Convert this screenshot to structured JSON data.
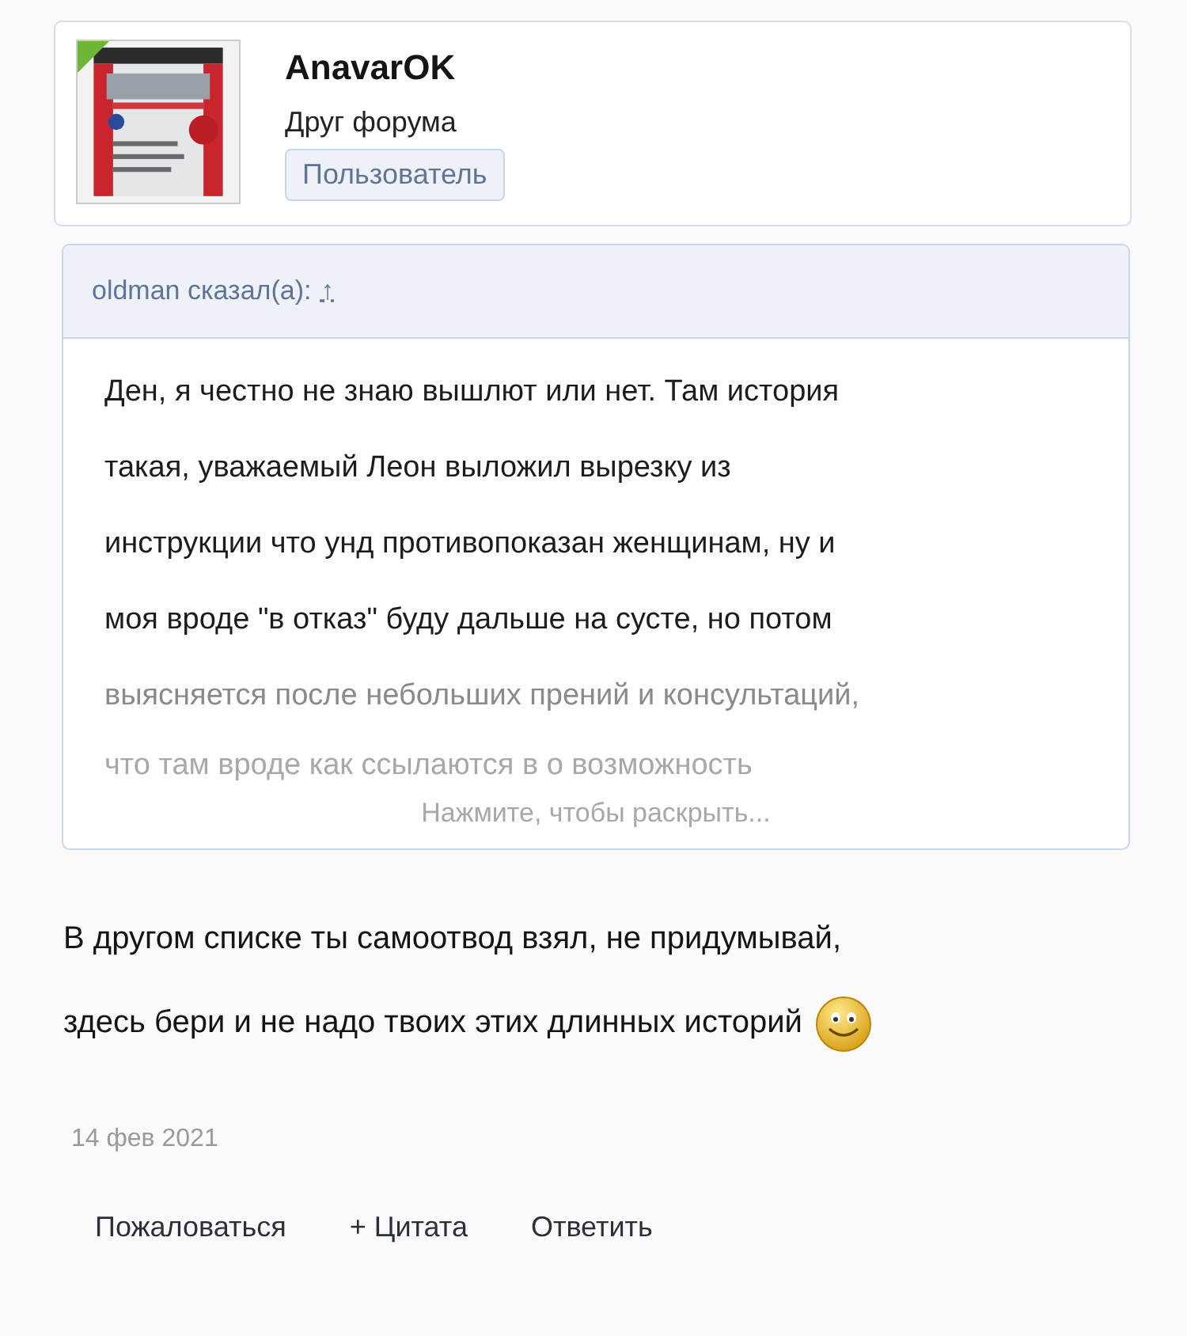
{
  "user": {
    "name": "AnavarOK",
    "title": "Друг форума",
    "badge": "Пользователь",
    "online": true
  },
  "quote": {
    "author_line": "oldman сказал(а):",
    "jump_link": "↑",
    "collapsed": true,
    "lines": [
      "Ден, я честно не знаю вышлют или нет. Там история",
      "такая, уважаемый Леон выложил вырезку из",
      "инструкции что унд противопоказан женщинам, ну и",
      "моя вроде \"в отказ\" буду дальше на сусте, но потом",
      "выясняется после небольших прений и консультаций,",
      "что там вроде как ссылаются в о возможность"
    ],
    "expand_link": "Нажмите, чтобы раскрыть..."
  },
  "message": {
    "lines": [
      "В другом списке ты самоотвод взял, не придумывай,",
      "здесь бери и не надо твоих этих длинных историй"
    ],
    "smiley": true
  },
  "date": "14 фев 2021",
  "actions": [
    "Пожаловаться",
    "+ Цитата",
    "Ответить"
  ]
}
